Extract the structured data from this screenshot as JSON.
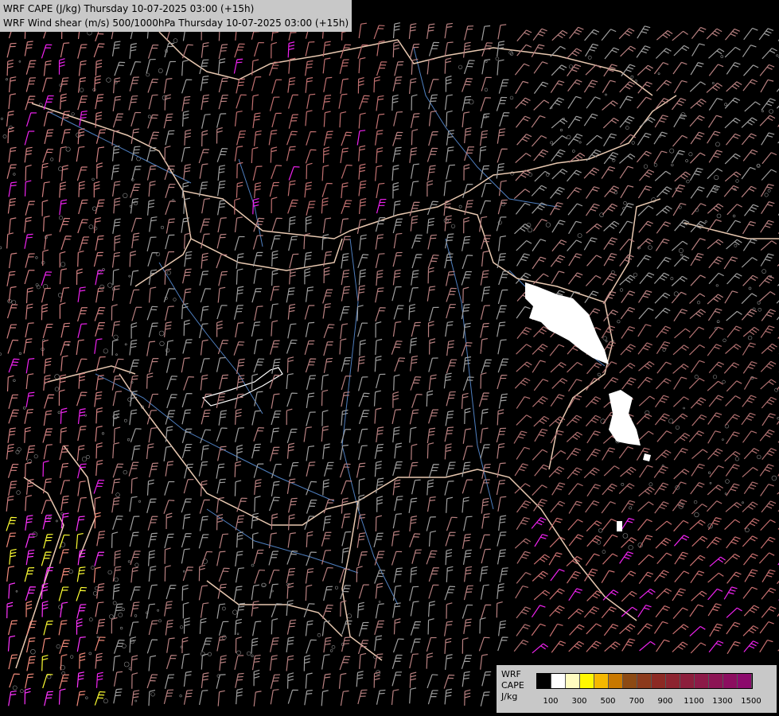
{
  "titles": [
    "WRF CAPE (J/kg) Thursday 10-07-2025 03:00 (+15h)",
    "WRF Wind shear (m/s) 500/1000hPa Thursday 10-07-2025 03:00 (+15h)"
  ],
  "legend": {
    "label_lines": [
      "WRF",
      "CAPE",
      "J/kg"
    ],
    "colors": [
      "#000000",
      "#ffffff",
      "#fffcbf",
      "#fff700",
      "#f5b800",
      "#c87800",
      "#8c4a14",
      "#8c3a1c",
      "#8c2a24",
      "#8c2430",
      "#8c1e3c",
      "#8c1a48",
      "#8c1454",
      "#8c0e60",
      "#8c0a6c"
    ],
    "ticks": [
      "100",
      "300",
      "500",
      "700",
      "900",
      "1100",
      "1300",
      "1500"
    ]
  },
  "map_colors": {
    "background": "#000000",
    "borders": "#e8c8b0",
    "rivers": "#4f7fc0",
    "terrain": "#b4b4b4"
  }
}
